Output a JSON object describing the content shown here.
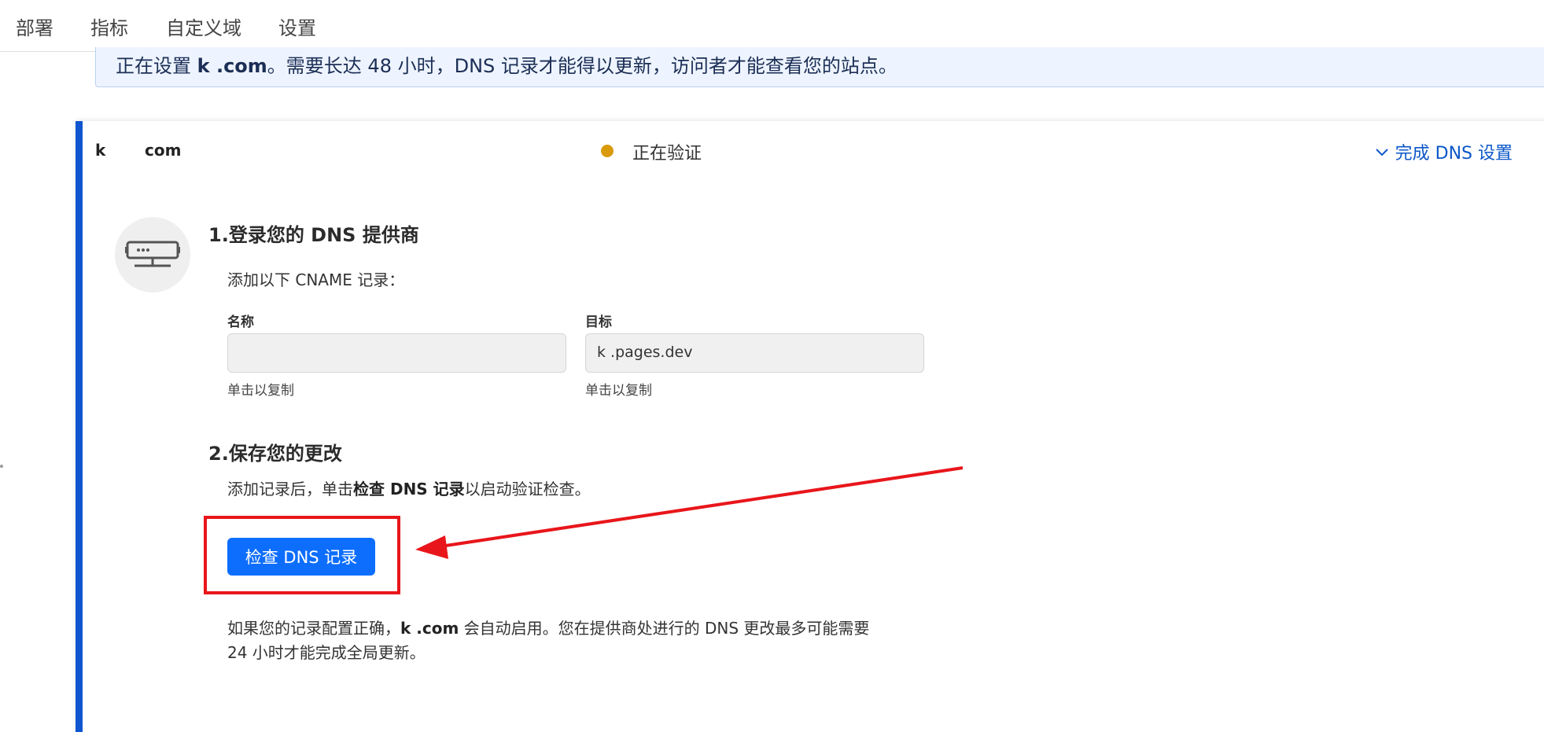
{
  "tabs": [
    {
      "label": "部署"
    },
    {
      "label": "指标"
    },
    {
      "label": "自定义域"
    },
    {
      "label": "设置"
    }
  ],
  "banner": {
    "prefix": "正在设置 ",
    "domain": "k      .com",
    "suffix": "。需要长达 48 小时，DNS 记录才能得以更新，访问者才能查看您的站点。"
  },
  "card": {
    "domain_start": "k",
    "domain_end": "com",
    "status": "正在验证",
    "status_color": "#d99b0a",
    "finish_link": "完成 DNS 设置",
    "finish_icon": "chevron-down-icon",
    "server_icon": "server-icon"
  },
  "step1": {
    "title": "1.登录您的 DNS 提供商",
    "instruction": "添加以下 CNAME 记录：",
    "name_label": "名称",
    "name_value": "",
    "name_hint": "单击以复制",
    "target_label": "目标",
    "target_value": "k      .pages.dev",
    "target_hint": "单击以复制"
  },
  "step2": {
    "title": "2.保存您的更改",
    "instruction_pre": "添加记录后，单击",
    "instruction_bold": "检查 DNS 记录",
    "instruction_post": "以启动验证检查。",
    "button_label": "检查 DNS 记录",
    "button_color": "#0d6efd",
    "annotation_color": "#e8161b"
  },
  "footer": {
    "line1_pre": "如果您的记录配置正确，",
    "line1_domain": "k      .com",
    "line1_post": " 会自动启用。您在提供商处进行的 DNS 更改最多可能需要",
    "line2": "24 小时才能完成全局更新。"
  }
}
